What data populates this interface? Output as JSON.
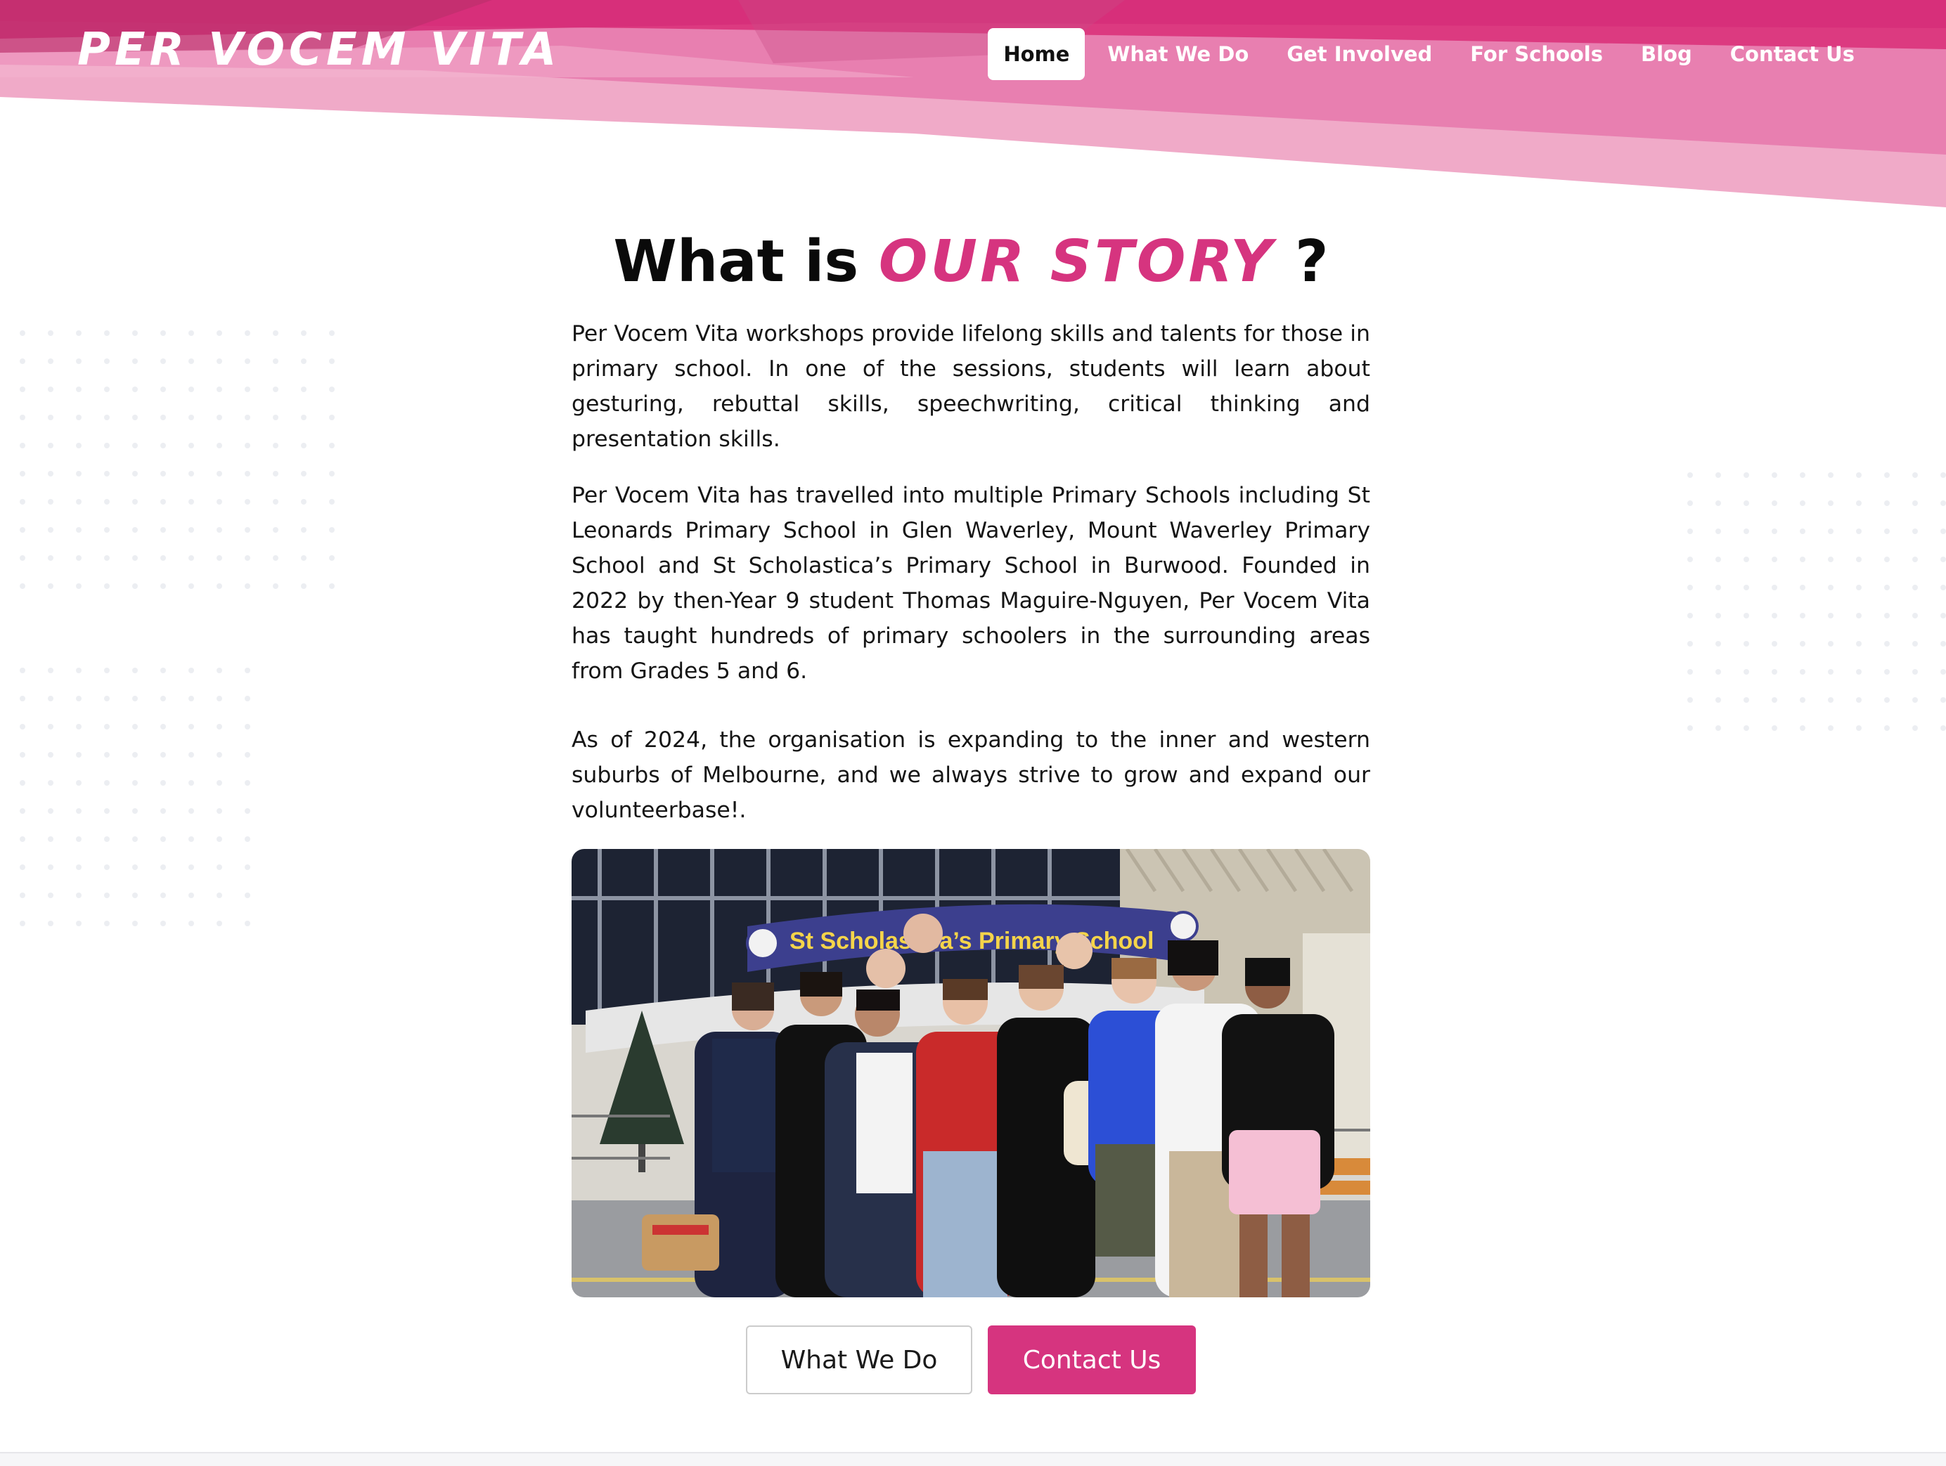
{
  "brand": {
    "logo_text": "PER VOCEM VITA",
    "accent_color": "#d6347f"
  },
  "nav": {
    "items": [
      {
        "label": "Home",
        "active": true
      },
      {
        "label": "What We Do",
        "active": false
      },
      {
        "label": "Get Involved",
        "active": false
      },
      {
        "label": "For Schools",
        "active": false
      },
      {
        "label": "Blog",
        "active": false
      },
      {
        "label": "Contact Us",
        "active": false
      }
    ]
  },
  "hero": {
    "title_prefix": "What is ",
    "title_accent": "OUR STORY",
    "title_suffix": " ?"
  },
  "story": {
    "paragraphs": [
      "Per Vocem Vita workshops provide lifelong skills and talents for those in primary school. In one of the sessions, students will learn about gesturing, rebuttal skills, speechwriting, critical thinking and presentation skills.",
      "Per Vocem Vita has travelled into multiple Primary Schools including St Leonards Primary School in Glen Waverley, Mount Waverley Primary School and St Scholastica’s Primary School in Burwood. Founded in 2022 by then-Year 9 student Thomas Maguire-Nguyen, Per Vocem Vita has taught hundreds of primary schoolers in the surrounding areas from Grades 5 and 6.",
      "As of 2024, the organisation is expanding to the inner and western suburbs of Melbourne, and we always strive to grow and expand our volunteerbase!."
    ]
  },
  "photo": {
    "sign_text": "St Scholastica’s Primary School"
  },
  "buttons": {
    "secondary_label": "What We Do",
    "primary_label": "Contact Us"
  }
}
